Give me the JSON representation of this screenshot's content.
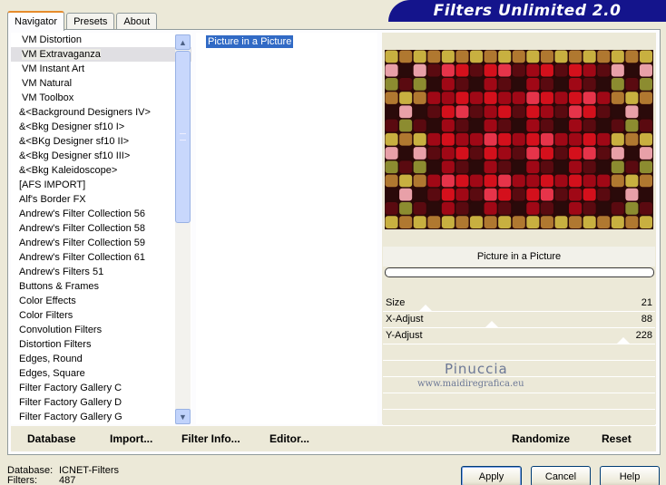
{
  "tabs": [
    {
      "label": "Navigator"
    },
    {
      "label": "Presets"
    },
    {
      "label": "About"
    }
  ],
  "banner": "Filters Unlimited 2.0",
  "filters": [
    "VM Distortion",
    "VM Extravaganza",
    "VM Instant Art",
    "VM Natural",
    "VM Toolbox",
    "&<Background Designers IV>",
    "&<Bkg Designer sf10 I>",
    "&<BKg Designer sf10 II>",
    "&<Bkg Designer sf10 III>",
    "&<Bkg Kaleidoscope>",
    "[AFS IMPORT]",
    "Alf's Border FX",
    "Andrew's Filter Collection 56",
    "Andrew's Filter Collection 58",
    "Andrew's Filter Collection 59",
    "Andrew's Filter Collection 61",
    "Andrew's Filters 51",
    "Buttons & Frames",
    "Color Effects",
    "Color Filters",
    "Convolution Filters",
    "Distortion Filters",
    "Edges, Round",
    "Edges, Square",
    "Filter Factory Gallery C",
    "Filter Factory Gallery D",
    "Filter Factory Gallery G"
  ],
  "selected_filter": "VM Extravaganza",
  "effects": [
    "Picture in a Picture"
  ],
  "effect_name": "Picture in a Picture",
  "params": [
    {
      "label": "Size",
      "value": "21",
      "level": 0.08
    },
    {
      "label": "X-Adjust",
      "value": "88",
      "level": 0.35
    },
    {
      "label": "Y-Adjust",
      "value": "228",
      "level": 0.89
    }
  ],
  "watermark": {
    "name": "Pinuccia",
    "url": "www.maidiregrafica.eu"
  },
  "list_buttons": {
    "database": "Database",
    "import": "Import...",
    "filter_info": "Filter Info...",
    "editor": "Editor..."
  },
  "preview_buttons": {
    "randomize": "Randomize",
    "reset": "Reset"
  },
  "footer": {
    "database_label": "Database:",
    "database_value": "ICNET-Filters",
    "filters_label": "Filters:",
    "filters_value": "487"
  },
  "dialog_buttons": {
    "apply": "Apply",
    "cancel": "Cancel",
    "help": "Help"
  },
  "colors": {
    "banner": "#14148c",
    "selection": "#316ac5",
    "tab_accent": "#e68b2c"
  }
}
